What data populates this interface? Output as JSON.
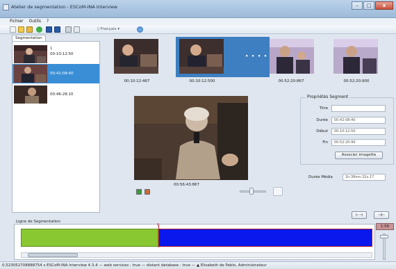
{
  "window": {
    "title": "Atelier de segmentation - ESCoM-INA Interview",
    "controls": [
      "–",
      "□",
      "x"
    ]
  },
  "menu": [
    "Fichier",
    "Outils",
    "?"
  ],
  "toolbar": {
    "language": "Français"
  },
  "segmentation": {
    "tab_label": "Segmentation",
    "items": [
      {
        "marker": "1",
        "time": "00:10:12:50",
        "selected": false
      },
      {
        "marker": "",
        "time": "00:42:08:40",
        "selected": true
      },
      {
        "marker": "",
        "time": "00:46:28:10",
        "selected": false
      }
    ]
  },
  "filmstrip": {
    "dots": "• • • •",
    "frames": [
      {
        "time": "00:10:12:467"
      },
      {
        "time": "00:10:12:500"
      },
      {
        "time": "00:52:20:867"
      },
      {
        "time": "00:52:20:900"
      }
    ]
  },
  "player": {
    "time": "00:56:43:867",
    "volume_level": 0.4
  },
  "properties": {
    "title": "Propriétés Segment",
    "fields": [
      {
        "label": "Titre",
        "value": ""
      },
      {
        "label": "Durée",
        "value": "00:42:08:40"
      },
      {
        "label": "Début",
        "value": "00:10:12:50"
      },
      {
        "label": "Fin",
        "value": "00:52:20:90"
      }
    ],
    "associate_button": "Associer imagette",
    "media_duration_label": "Durée Média",
    "media_duration_value": "1h:36mn:32s:17"
  },
  "actions": {
    "left_button": "⊢⊣",
    "right_button": "⊣⊢"
  },
  "timeline": {
    "label": "Ligne de Segmentation",
    "zoom": "1:56",
    "cursor_mark": "0",
    "segment_colors": [
      "#8ac832",
      "#0a18ee"
    ]
  },
  "status": {
    "text": "0,523052708888754 s  ESCoM-INA Interview 4.3.4  —  web services : true  —  distant database : true  —",
    "user": "Elisabeth de Pablo, Administrateur"
  }
}
